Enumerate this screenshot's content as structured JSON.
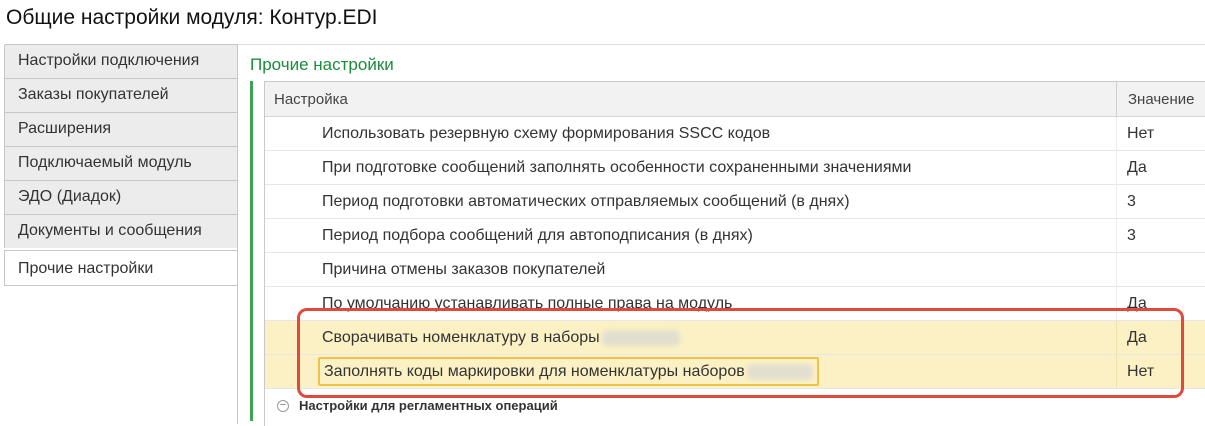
{
  "window": {
    "title": "Общие настройки модуля: Контур.EDI"
  },
  "tabs": [
    {
      "label": "Настройки подключения"
    },
    {
      "label": "Заказы покупателей"
    },
    {
      "label": "Расширения"
    },
    {
      "label": "Подключаемый модуль"
    },
    {
      "label": "ЭДО (Диадок)"
    },
    {
      "label": "Документы и сообщения"
    },
    {
      "label": "Прочие настройки"
    }
  ],
  "section": {
    "title": "Прочие настройки",
    "columns": {
      "setting": "Настройка",
      "value": "Значение"
    },
    "rows": [
      {
        "setting": "Использовать резервную схему формирования SSCC кодов",
        "value": "Нет"
      },
      {
        "setting": "При подготовке сообщений заполнять особенности сохраненными значениями",
        "value": "Да"
      },
      {
        "setting": "Период подготовки автоматических отправляемых сообщений (в днях)",
        "value": "3"
      },
      {
        "setting": "Период подбора сообщений для автоподписания (в днях)",
        "value": "3"
      },
      {
        "setting": "Причина отмены заказов покупателей",
        "value": ""
      },
      {
        "setting": "По умолчанию устанавливать полные права на модуль",
        "value": "Да"
      },
      {
        "setting": "Сворачивать номенклатуру в наборы",
        "value": "Да"
      },
      {
        "setting": "Заполнять коды маркировки для номенклатуры наборов",
        "value": "Нет"
      }
    ],
    "group_row": {
      "label": "Настройки для регламентных операций",
      "icon": "collapse-icon"
    }
  },
  "colors": {
    "accent_green": "#1a8c3b",
    "highlight_row": "#fbf1c4",
    "focus_border": "#f0c24a",
    "annotation_red": "#e04a3c"
  }
}
